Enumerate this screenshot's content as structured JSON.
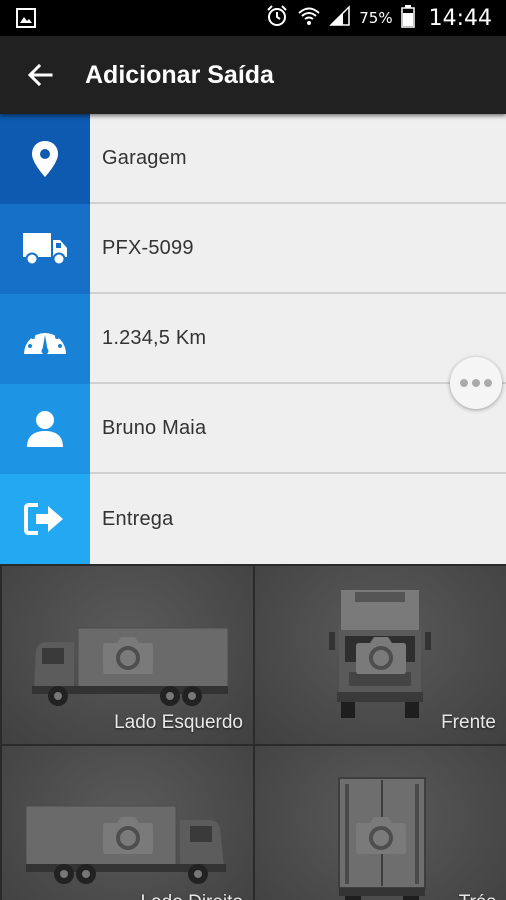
{
  "status_bar": {
    "battery_percent": "75%",
    "time": "14:44"
  },
  "app_bar": {
    "title": "Adicionar Saída"
  },
  "colors": {
    "row_icon_backgrounds": [
      "#0d5ab0",
      "#1670c8",
      "#1a82d6",
      "#1e94e4",
      "#22a9f2"
    ]
  },
  "form_rows": [
    {
      "icon": "location-pin-icon",
      "value": "Garagem"
    },
    {
      "icon": "truck-icon",
      "value": "PFX-5099"
    },
    {
      "icon": "speedometer-icon",
      "value": "1.234,5 Km"
    },
    {
      "icon": "person-icon",
      "value": "Bruno Maia"
    },
    {
      "icon": "exit-icon",
      "value": "Entrega"
    }
  ],
  "photos": [
    {
      "label": "Lado Esquerdo"
    },
    {
      "label": "Frente"
    },
    {
      "label": "Lado Direito"
    },
    {
      "label": "Trás"
    }
  ]
}
